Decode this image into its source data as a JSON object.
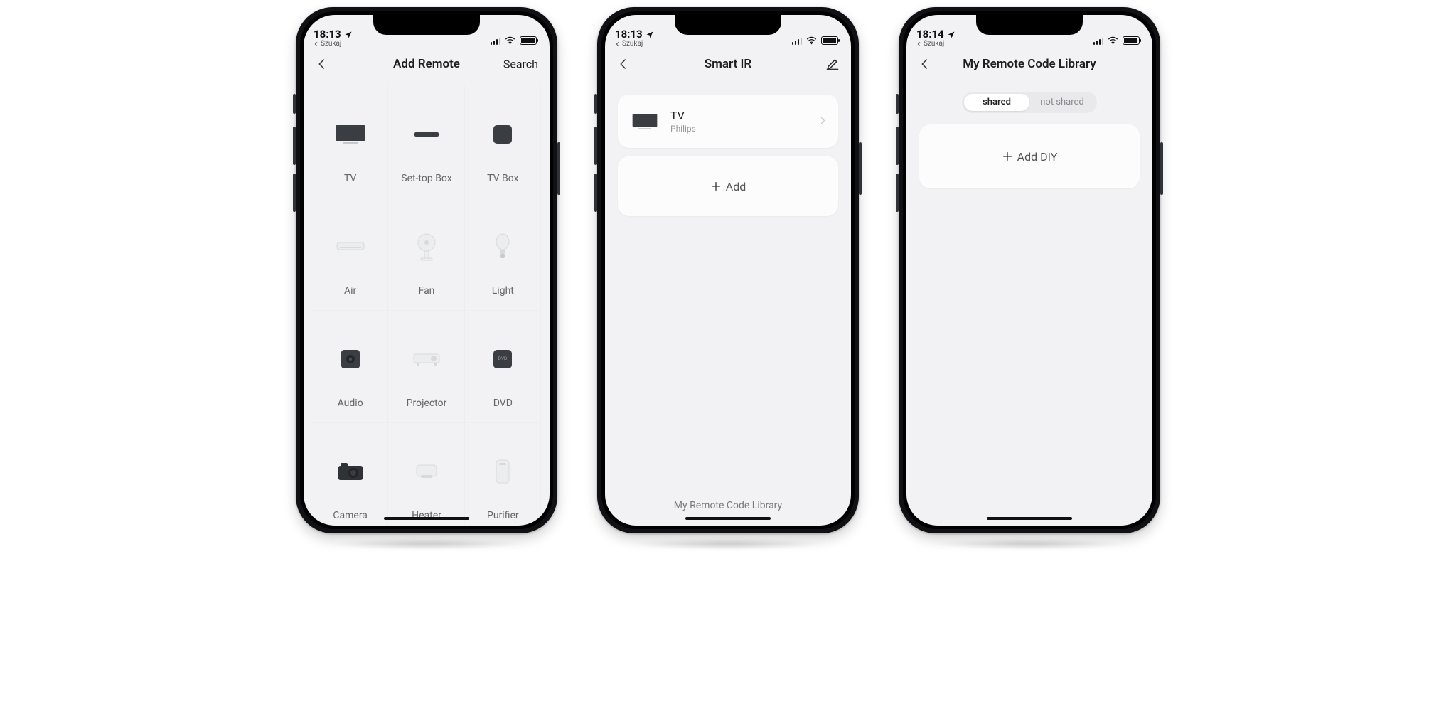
{
  "status": {
    "back_app": "Szukaj"
  },
  "screens": [
    {
      "time": "18:13",
      "title": "Add Remote",
      "right_action": "Search",
      "devices": [
        {
          "label": "TV",
          "icon": "tv"
        },
        {
          "label": "Set-top Box",
          "icon": "settop"
        },
        {
          "label": "TV Box",
          "icon": "tvbox"
        },
        {
          "label": "Air",
          "icon": "air"
        },
        {
          "label": "Fan",
          "icon": "fan"
        },
        {
          "label": "Light",
          "icon": "light"
        },
        {
          "label": "Audio",
          "icon": "audio"
        },
        {
          "label": "Projector",
          "icon": "projector"
        },
        {
          "label": "DVD",
          "icon": "dvd"
        },
        {
          "label": "Camera",
          "icon": "camera"
        },
        {
          "label": "Heater",
          "icon": "heater"
        },
        {
          "label": "Purifier",
          "icon": "purifier"
        }
      ]
    },
    {
      "time": "18:13",
      "title": "Smart IR",
      "right_action_icon": "edit",
      "remote": {
        "name": "TV",
        "brand": "Philips"
      },
      "add_label": "Add",
      "bottom_link": "My Remote Code Library"
    },
    {
      "time": "18:14",
      "title": "My Remote Code Library",
      "segments": [
        "shared",
        "not shared"
      ],
      "active_segment": 0,
      "add_diy_label": "Add DIY"
    }
  ]
}
